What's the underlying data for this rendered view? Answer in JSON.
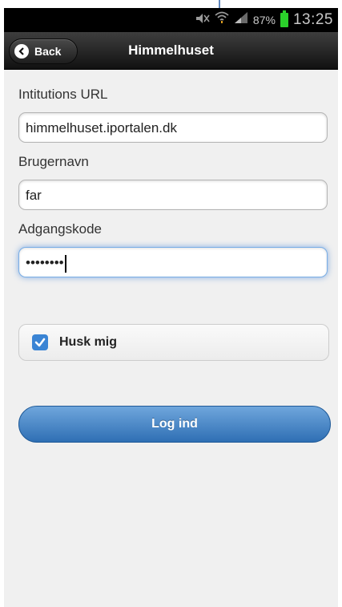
{
  "status_bar": {
    "battery_percent": "87%",
    "time": "13:25",
    "icons": [
      "notification-muted-icon",
      "wifi-icon",
      "signal-icon",
      "battery-icon"
    ]
  },
  "header": {
    "back_label": "Back",
    "title": "Himmelhuset"
  },
  "form": {
    "url_label": "Intitutions URL",
    "url_value": "himmelhuset.iportalen.dk",
    "username_label": "Brugernavn",
    "username_value": "far",
    "password_label": "Adgangskode",
    "password_mask": "••••••••",
    "remember_label": "Husk mig",
    "remember_checked": true,
    "login_label": "Log ind"
  },
  "colors": {
    "accent": "#3a84d4",
    "button_top": "#6fa6dc",
    "button_bottom": "#2f6fb4",
    "header_bg": "#1d1d1d",
    "content_bg": "#f0f0f0",
    "focus_glow": "#7aaee6",
    "battery": "#2bd12b",
    "annotation_arrow": "#2a5fa8"
  }
}
